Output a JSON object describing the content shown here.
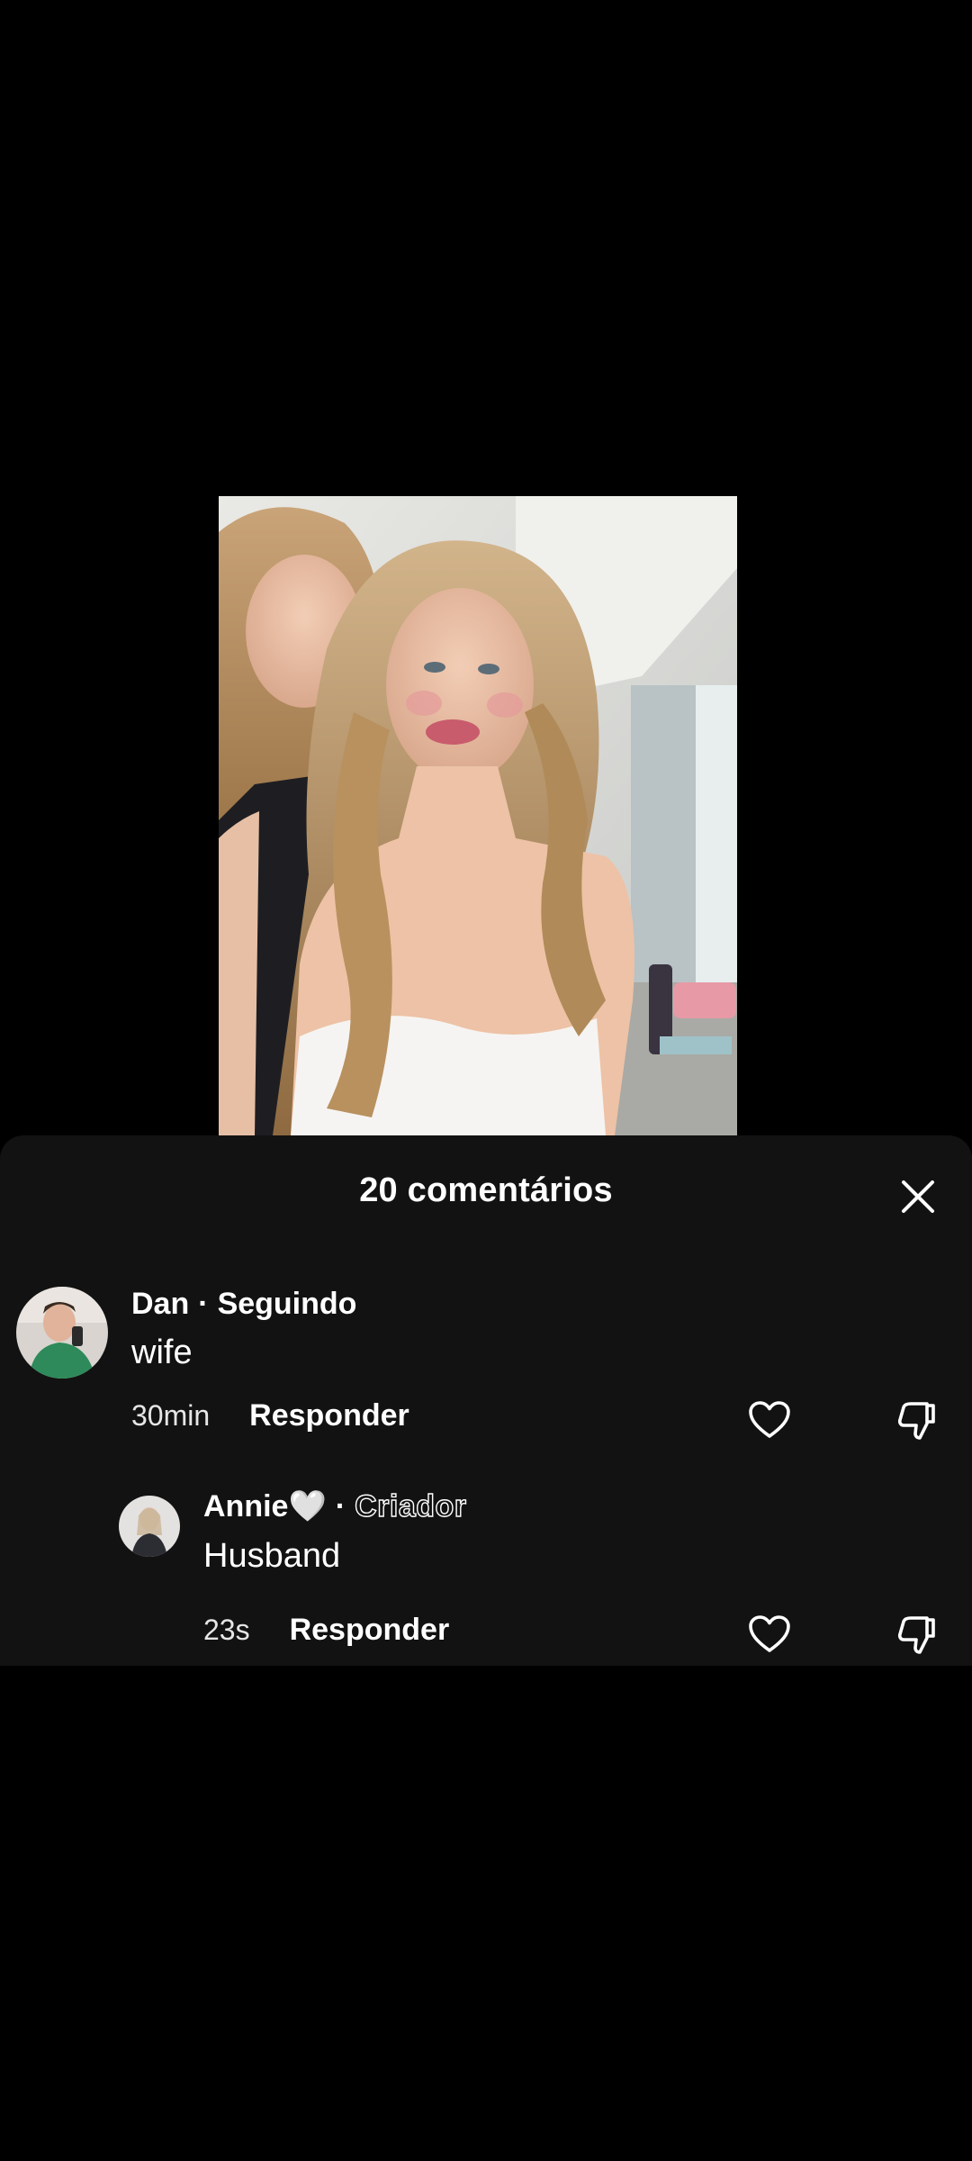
{
  "comments_sheet": {
    "title": "20 comentários",
    "close_icon": "close-icon"
  },
  "comments": [
    {
      "username": "Dan",
      "separator": "·",
      "relation": "Seguindo",
      "text": "wife",
      "time": "30min",
      "reply_label": "Responder",
      "like_icon": "heart-outline-icon",
      "dislike_icon": "thumbs-down-icon"
    },
    {
      "username": "Annie🤍",
      "separator": "·",
      "relation": "Criador",
      "text": "Husband",
      "time": "23s",
      "reply_label": "Responder",
      "like_icon": "heart-outline-icon",
      "dislike_icon": "thumbs-down-icon"
    }
  ],
  "colors": {
    "background": "#000000",
    "sheet": "#121212",
    "text": "#ffffff"
  }
}
